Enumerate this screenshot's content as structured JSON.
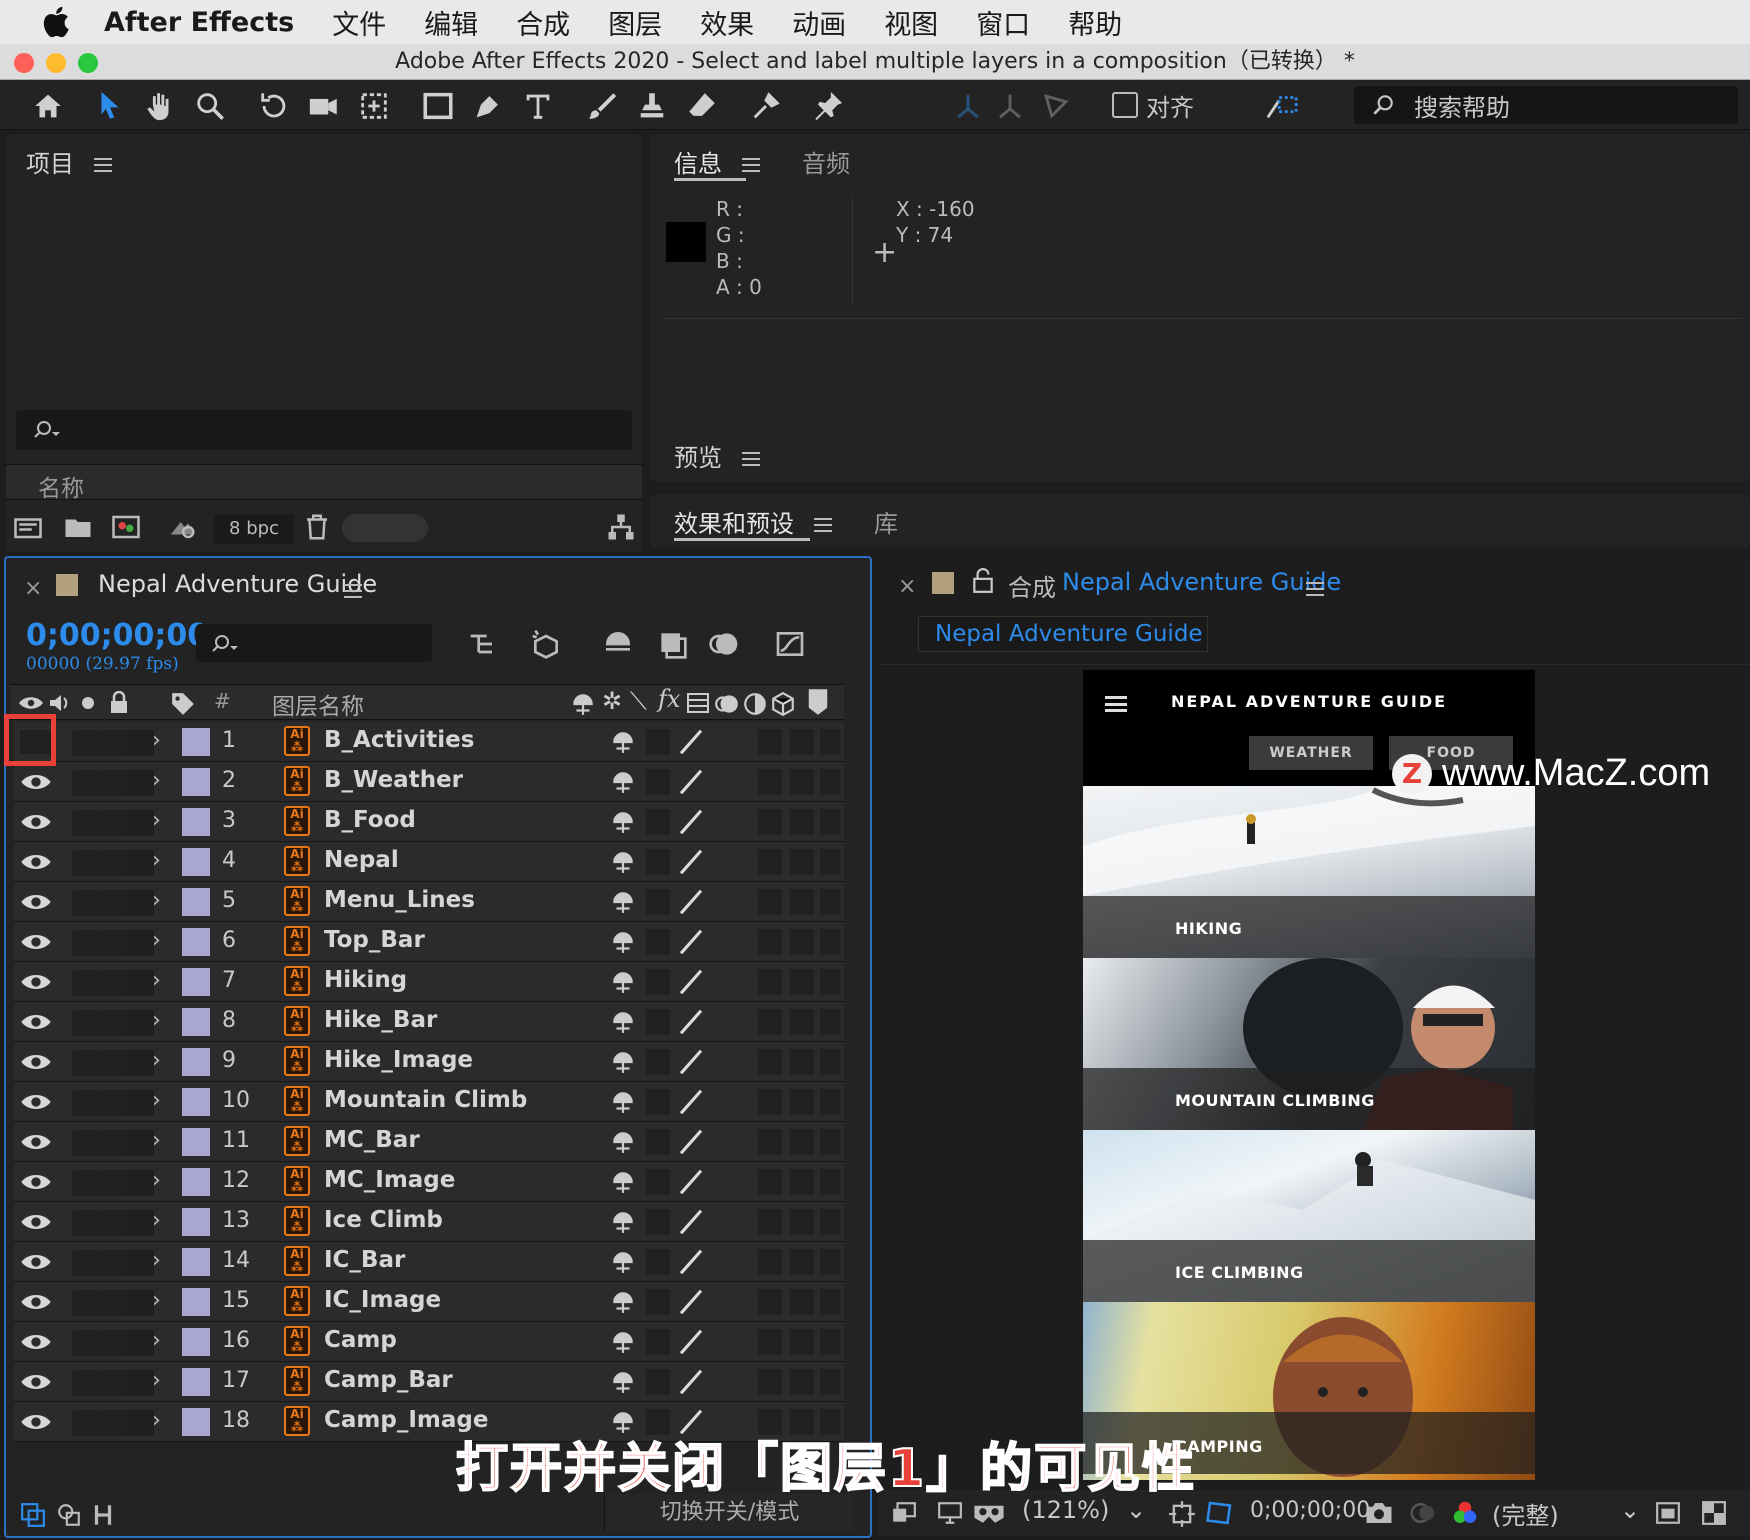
{
  "menubar": {
    "app_name": "After Effects",
    "items": [
      "文件",
      "编辑",
      "合成",
      "图层",
      "效果",
      "动画",
      "视图",
      "窗口",
      "帮助"
    ]
  },
  "window": {
    "title": "Adobe After Effects 2020 - Select and label multiple layers in a composition（已转换） *"
  },
  "toolbar": {
    "align_label": "对齐",
    "search_placeholder": "搜索帮助",
    "tools": [
      "home-icon",
      "selection-tool-icon",
      "hand-tool-icon",
      "zoom-tool-icon",
      "rotate-tool-icon",
      "camera-tool-icon",
      "pan-behind-tool-icon",
      "rectangle-tool-icon",
      "pen-tool-icon",
      "type-tool-icon",
      "brush-tool-icon",
      "clone-stamp-tool-icon",
      "eraser-tool-icon",
      "roto-brush-tool-icon",
      "puppet-pin-tool-icon"
    ]
  },
  "project_panel": {
    "title": "项目",
    "column_name": "名称",
    "bpc": "8 bpc"
  },
  "info_panel": {
    "tabs": [
      "信息",
      "音频"
    ],
    "r_label": "R :",
    "g_label": "G :",
    "b_label": "B :",
    "a_label": "A :",
    "a_value": "0",
    "x_label": "X :",
    "x_value": "-160",
    "y_label": "Y :",
    "y_value": "74"
  },
  "preview_panel": {
    "title": "预览"
  },
  "effects_panel": {
    "tabs": [
      "效果和预设",
      "库"
    ]
  },
  "timeline": {
    "comp_name": "Nepal Adventure Guide",
    "timecode": "0;00;00;00",
    "frame_info": "00000 (29.97 fps)",
    "col_number": "#",
    "col_layer_name": "图层名称",
    "toggle_label": "切换开关/模式",
    "layers": [
      {
        "num": "1",
        "name": "B_Activities",
        "visible": false
      },
      {
        "num": "2",
        "name": "B_Weather",
        "visible": true
      },
      {
        "num": "3",
        "name": "B_Food",
        "visible": true
      },
      {
        "num": "4",
        "name": "Nepal",
        "visible": true
      },
      {
        "num": "5",
        "name": "Menu_Lines",
        "visible": true
      },
      {
        "num": "6",
        "name": "Top_Bar",
        "visible": true
      },
      {
        "num": "7",
        "name": "Hiking",
        "visible": true
      },
      {
        "num": "8",
        "name": "Hike_Bar",
        "visible": true
      },
      {
        "num": "9",
        "name": "Hike_Image",
        "visible": true
      },
      {
        "num": "10",
        "name": "Mountain Climb",
        "visible": true
      },
      {
        "num": "11",
        "name": "MC_Bar",
        "visible": true
      },
      {
        "num": "12",
        "name": "MC_Image",
        "visible": true
      },
      {
        "num": "13",
        "name": "Ice Climb",
        "visible": true
      },
      {
        "num": "14",
        "name": "IC_Bar",
        "visible": true
      },
      {
        "num": "15",
        "name": "IC_Image",
        "visible": true
      },
      {
        "num": "16",
        "name": "Camp",
        "visible": true
      },
      {
        "num": "17",
        "name": "Camp_Bar",
        "visible": true
      },
      {
        "num": "18",
        "name": "Camp_Image",
        "visible": true
      }
    ]
  },
  "composition": {
    "label": "合成",
    "name": "Nepal Adventure Guide",
    "flow_tab": "Nepal Adventure Guide",
    "app_title": "NEPAL ADVENTURE GUIDE",
    "nav_buttons": [
      "WEATHER",
      "FOOD"
    ],
    "tiles": [
      "HIKING",
      "MOUNTAIN CLIMBING",
      "ICE CLIMBING",
      "CAMPING"
    ],
    "zoom": "(121%)",
    "timecode": "0;00;00;00",
    "resolution": "(完整)"
  },
  "overlays": {
    "watermark": "www.MacZ.com",
    "caption": "打开并关闭「图层1」的可见性"
  },
  "colors": {
    "accent_blue": "#2d8ceb",
    "highlight_red": "#e8413a",
    "layer_label": "#a9a6cf",
    "ai_orange": "#e6781a"
  }
}
